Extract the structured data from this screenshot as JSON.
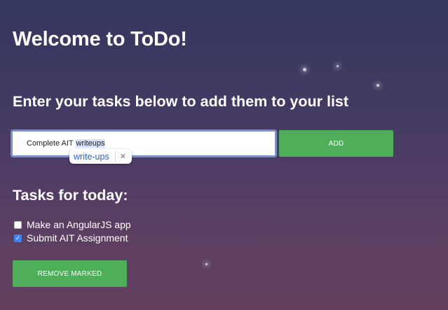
{
  "page": {
    "title": "Welcome to ToDo!",
    "subtitle": "Enter your tasks below to add them to your list"
  },
  "input": {
    "value_prefix": "Complete AIT ",
    "value_misspelled": "writeups",
    "spell_suggestion": "write-ups",
    "dismiss_glyph": "✕"
  },
  "add_button": {
    "label": "ADD"
  },
  "tasks": {
    "heading": "Tasks for today:",
    "items": [
      {
        "label": "Make an AngularJS app",
        "checked": false
      },
      {
        "label": "Submit AIT Assignment",
        "checked": true,
        "check_glyph": "✓"
      }
    ]
  },
  "remove_button": {
    "label": "REMOVE MARKED"
  },
  "colors": {
    "button_green": "#4fae5a",
    "checkbox_blue": "#3f83f4",
    "input_focus_border": "#7a93cf",
    "suggestion_text": "#2f5fbf"
  }
}
